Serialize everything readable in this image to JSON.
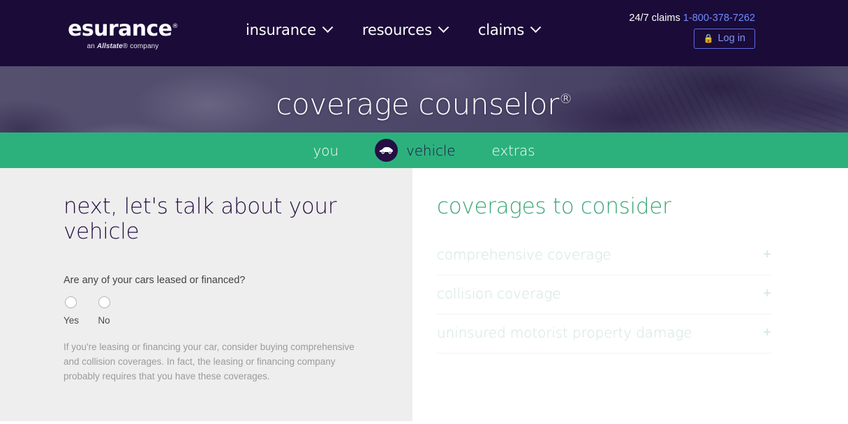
{
  "header": {
    "logo": {
      "name": "esurance",
      "registered": "®",
      "tagline_prefix": "an ",
      "tagline_brand": "Allstate",
      "tagline_reg": "®",
      "tagline_suffix": " company"
    },
    "nav": [
      {
        "label": "insurance",
        "icon": "chevron-down-icon"
      },
      {
        "label": "resources",
        "icon": "chevron-down-icon"
      },
      {
        "label": "claims",
        "icon": "chevron-down-icon"
      }
    ],
    "claims_label": "24/7 claims",
    "claims_phone": "1-800-378-7262",
    "login_label": "Log in",
    "login_icon": "lock-icon",
    "colors": {
      "nav_background": "#1b0b38",
      "phone_link": "#6f8cff",
      "login_border": "#5b6ee0",
      "login_text": "#7f93f5"
    }
  },
  "hero": {
    "title": "coverage counselor",
    "trademark": "®",
    "background_color": "#4c4668"
  },
  "steps": {
    "background_color": "#2cb17d",
    "items": [
      {
        "label": "you",
        "active": false,
        "icon": ""
      },
      {
        "label": "vehicle",
        "active": true,
        "icon": "car-icon"
      },
      {
        "label": "extras",
        "active": false,
        "icon": ""
      }
    ]
  },
  "main": {
    "left": {
      "background_color": "#eeeeee",
      "title": "next, let's talk about your vehicle",
      "question": "Are any of your cars leased or financed?",
      "options": [
        {
          "label": "Yes",
          "selected": false
        },
        {
          "label": "No",
          "selected": false
        }
      ],
      "helper_text": "If you're leasing or financing your car, consider buying comprehensive and collision coverages. In fact, the leasing or financing company probably requires that you have these coverages."
    },
    "right": {
      "title": "coverages to consider",
      "title_color": "#3aa576",
      "items": [
        {
          "label": "comprehensive coverage",
          "expander": "+"
        },
        {
          "label": "collision coverage",
          "expander": "+"
        },
        {
          "label": "uninsured motorist property damage",
          "expander": "+"
        }
      ]
    }
  }
}
